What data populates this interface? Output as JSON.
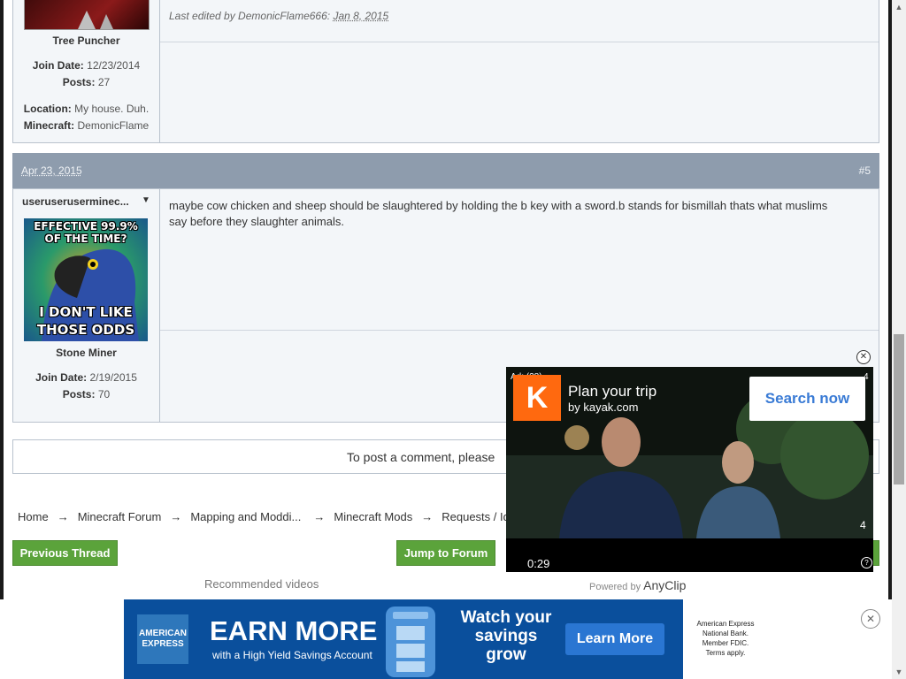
{
  "post1": {
    "user_title": "Tree Puncher",
    "join_label": "Join Date:",
    "join_value": "12/23/2014",
    "posts_label": "Posts:",
    "posts_value": "27",
    "location_label": "Location:",
    "location_value": "My house. Duh.",
    "minecraft_label": "Minecraft:",
    "minecraft_value": "DemonicFlame",
    "edited_prefix": "Last edited by DemonicFlame666:",
    "edited_date": "Jan 8, 2015"
  },
  "post2": {
    "date": "Apr 23, 2015",
    "number": "#5",
    "username": "useruseruserminec...",
    "avatar_top_text": "EFFECTIVE 99.9% OF THE TIME?",
    "avatar_bottom_text": "I DON'T LIKE THOSE ODDS",
    "user_title": "Stone Miner",
    "join_label": "Join Date:",
    "join_value": "2/19/2015",
    "posts_label": "Posts:",
    "posts_value": "70",
    "text": "maybe cow chicken and sheep should be slaughtered by holding the b key with a sword.b stands for bismillah thats what muslims say before they slaughter animals."
  },
  "comment_prompt": "To post a comment, please",
  "breadcrumbs": [
    "Home",
    "Minecraft Forum",
    "Mapping and Moddi...",
    "Minecraft Mods",
    "Requests / Ide"
  ],
  "breadcrumb_separator": "→",
  "nav": {
    "previous_thread": "Previous Thread",
    "jump_to_forum": "Jump to Forum"
  },
  "recommended_videos": "Recommended videos",
  "video_ad": {
    "ad_label": "Ad: (28)",
    "logo_letter": "K",
    "title": "Plan your trip",
    "subtitle": "by kayak.com",
    "cta": "Search now",
    "count_top": "4",
    "count": "4",
    "time": "0:29",
    "powered_by": "Powered by",
    "powered_brand": "AnyClip"
  },
  "banner_ad": {
    "brand_line1": "AMERICAN",
    "brand_line2": "EXPRESS",
    "headline": "EARN MORE",
    "subline": "with a High Yield Savings Account",
    "watch_line1": "Watch your",
    "watch_line2": "savings",
    "watch_line3": "grow",
    "cta": "Learn More",
    "fine_print": "American Express National Bank. Member FDIC. Terms apply."
  },
  "colors": {
    "post_header": "#8e9cad",
    "button_green": "#5ba33b",
    "kayak_orange": "#ff690f",
    "amex_blue": "#0a4f9c"
  }
}
